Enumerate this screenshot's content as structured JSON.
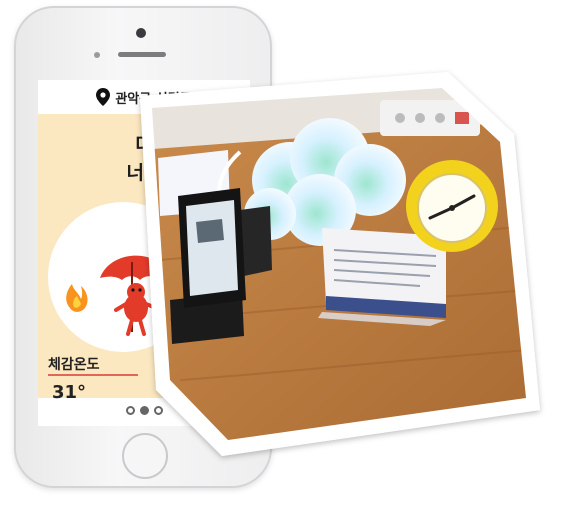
{
  "app": {
    "location": "관악구 신림동",
    "headline_line1": "더",
    "headline_line2": "너무",
    "feels_like_label": "체감온도",
    "temperature": "31°",
    "page_indicator": {
      "pages": 3,
      "active": 1
    }
  },
  "colors": {
    "app_background": "#fbe7c0",
    "accent_red": "#e0665a",
    "phone_body": "#efeff0",
    "mascot_red": "#e23b2a",
    "flame_orange": "#f7931e"
  },
  "icons": [
    "location-pin-icon",
    "flame-icon",
    "umbrella-mascot-icon"
  ]
}
